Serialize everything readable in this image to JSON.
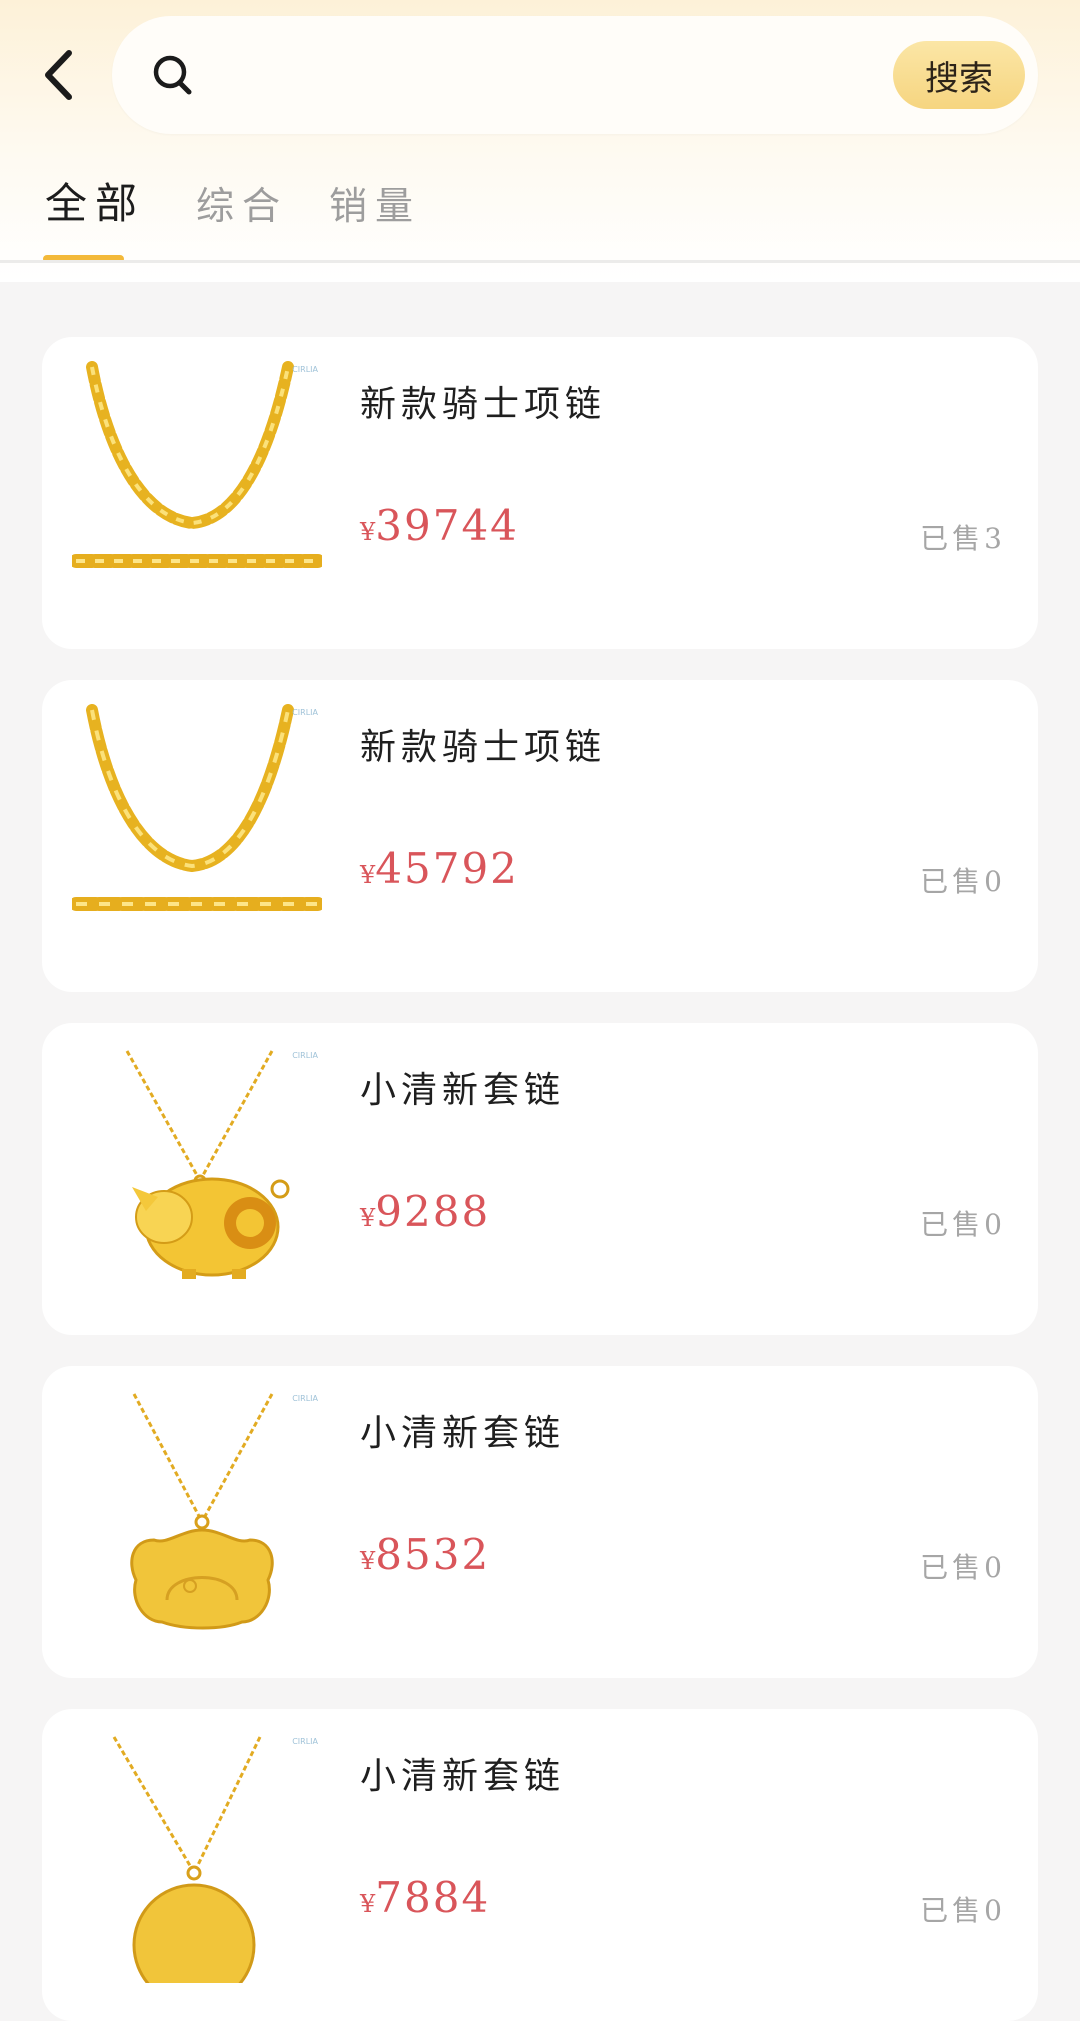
{
  "header": {
    "search": {
      "placeholder": "",
      "value": "",
      "button_label": "搜索"
    }
  },
  "tabs": [
    {
      "label": "全部",
      "active": true
    },
    {
      "label": "综合",
      "active": false
    },
    {
      "label": "销量",
      "active": false
    }
  ],
  "colors": {
    "accent": "#f3b93a",
    "price": "#d9555a",
    "search_button": "#f6d580"
  },
  "products": [
    {
      "title": "新款骑士项链",
      "currency": "¥",
      "price": "39744",
      "sold": "已售3",
      "image": "gold-chain-necklace"
    },
    {
      "title": "新款骑士项链",
      "currency": "¥",
      "price": "45792",
      "sold": "已售0",
      "image": "gold-chain-necklace"
    },
    {
      "title": "小清新套链",
      "currency": "¥",
      "price": "9288",
      "sold": "已售0",
      "image": "gold-pig-pendant-necklace"
    },
    {
      "title": "小清新套链",
      "currency": "¥",
      "price": "8532",
      "sold": "已售0",
      "image": "gold-lock-pendant-necklace"
    },
    {
      "title": "小清新套链",
      "currency": "¥",
      "price": "7884",
      "sold": "已售0",
      "image": "gold-round-pendant-necklace"
    }
  ]
}
